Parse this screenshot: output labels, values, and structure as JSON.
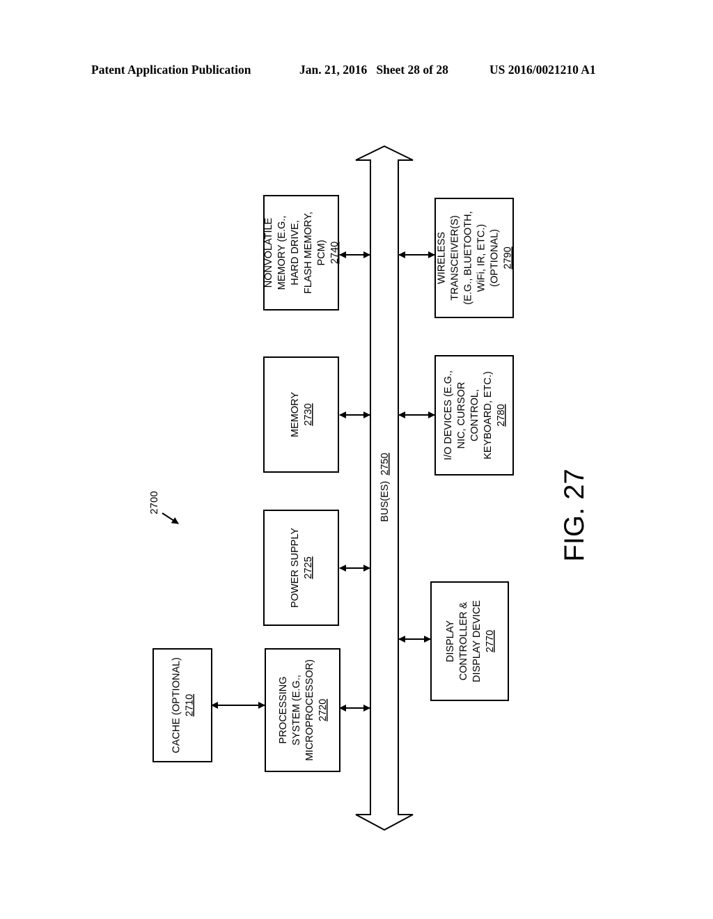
{
  "header": {
    "publication_type": "Patent Application Publication",
    "date_sheet": "Jan. 21, 2016   Sheet 28 of 28",
    "patent_number": "US 2016/0021210 A1"
  },
  "figure": {
    "label": "FIG. 27",
    "reference": "2700"
  },
  "bus": {
    "label": "BUS(ES)",
    "number": "2750"
  },
  "blocks": [
    {
      "id": "cache",
      "lines": [
        "CACHE (OPTIONAL)"
      ],
      "number": "2710"
    },
    {
      "id": "processing",
      "lines": [
        "PROCESSING",
        "SYSTEM (E.G.,",
        "MICROPROCESSOR)"
      ],
      "number": "2720"
    },
    {
      "id": "power",
      "lines": [
        "POWER SUPPLY"
      ],
      "number": "2725"
    },
    {
      "id": "memory",
      "lines": [
        "MEMORY"
      ],
      "number": "2730"
    },
    {
      "id": "nonvolatile",
      "lines": [
        "NONVOLATILE",
        "MEMORY (E.G.,",
        "HARD DRIVE,",
        "FLASH MEMORY,",
        "PCM)"
      ],
      "number": "2740"
    },
    {
      "id": "display",
      "lines": [
        "DISPLAY",
        "CONTROLLER &",
        "DISPLAY DEVICE"
      ],
      "number": "2770"
    },
    {
      "id": "io",
      "lines": [
        "I/O DEVICES (E.G.,",
        "NIC, CURSOR",
        "CONTROL,",
        "KEYBOARD, ETC.)"
      ],
      "number": "2780"
    },
    {
      "id": "wireless",
      "lines": [
        "WIRELESS",
        "TRANSCEIVER(S)",
        "(E.G., BLUETOOTH,",
        "WiFi, IR, ETC.)",
        "(OPTIONAL)"
      ],
      "number": "2790"
    }
  ],
  "connections": [
    {
      "from": "cache",
      "to": "processing",
      "type": "bidirectional"
    },
    {
      "from": "processing",
      "to": "bus",
      "type": "bidirectional"
    },
    {
      "from": "power",
      "to": "bus",
      "type": "bidirectional"
    },
    {
      "from": "memory",
      "to": "bus",
      "type": "bidirectional"
    },
    {
      "from": "nonvolatile",
      "to": "bus",
      "type": "bidirectional"
    },
    {
      "from": "bus",
      "to": "display",
      "type": "bidirectional"
    },
    {
      "from": "bus",
      "to": "io",
      "type": "bidirectional"
    },
    {
      "from": "bus",
      "to": "wireless",
      "type": "bidirectional"
    }
  ]
}
